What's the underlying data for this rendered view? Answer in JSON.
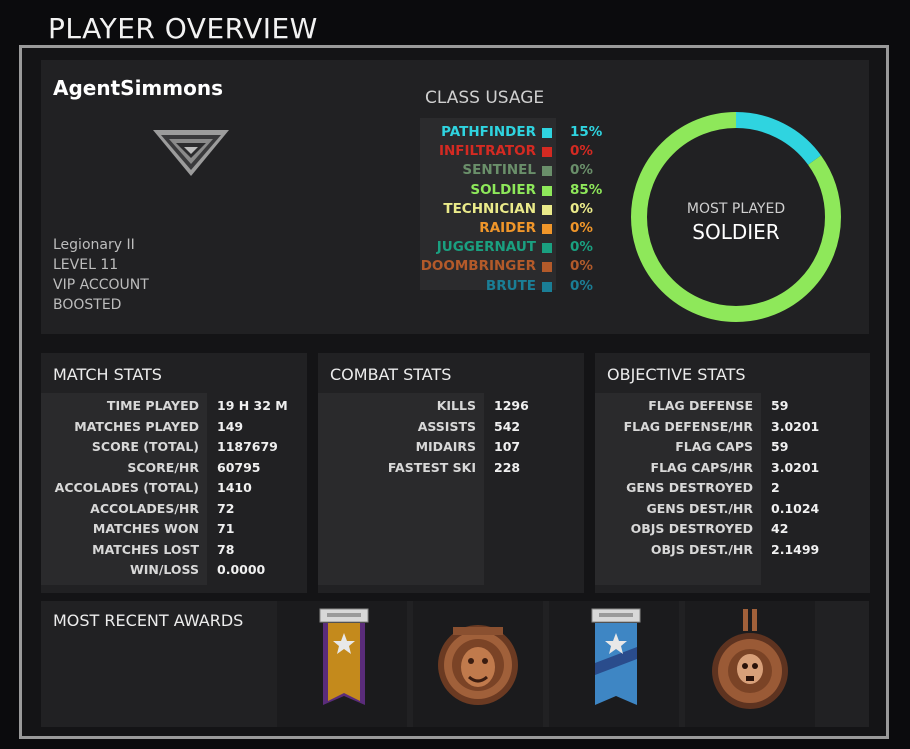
{
  "page": {
    "title": "PLAYER OVERVIEW"
  },
  "profile": {
    "player_name": "AgentSimmons",
    "rank": "Legionary II",
    "level": "LEVEL 11",
    "account": "VIP ACCOUNT",
    "boost": "BOOSTED",
    "emblem_icon": "rank-chevron-icon"
  },
  "class_usage": {
    "title": "CLASS USAGE",
    "classes": [
      {
        "name": "PATHFINDER",
        "percent": "15%",
        "color": "#2fd4e0"
      },
      {
        "name": "INFILTRATOR",
        "percent": "0%",
        "color": "#d42a22"
      },
      {
        "name": "SENTINEL",
        "percent": "0%",
        "color": "#6a8f6a"
      },
      {
        "name": "SOLDIER",
        "percent": "85%",
        "color": "#8ee85a"
      },
      {
        "name": "TECHNICIAN",
        "percent": "0%",
        "color": "#eaea8a"
      },
      {
        "name": "RAIDER",
        "percent": "0%",
        "color": "#f0962a"
      },
      {
        "name": "JUGGERNAUT",
        "percent": "0%",
        "color": "#1aa080"
      },
      {
        "name": "DOOMBRINGER",
        "percent": "0%",
        "color": "#b35a2a"
      },
      {
        "name": "BRUTE",
        "percent": "0%",
        "color": "#1a7e96"
      }
    ],
    "most_played_label": "MOST PLAYED",
    "most_played_class": "SOLDIER"
  },
  "chart_data": {
    "type": "pie",
    "style": "donut",
    "categories": [
      "PATHFINDER",
      "SOLDIER"
    ],
    "values": [
      15,
      85
    ],
    "colors": [
      "#2fd4e0",
      "#8ee85a"
    ]
  },
  "match_stats": {
    "title": "MATCH STATS",
    "rows": [
      {
        "label": "TIME PLAYED",
        "value": "19 H 32 M"
      },
      {
        "label": "MATCHES PLAYED",
        "value": "149"
      },
      {
        "label": "SCORE (TOTAL)",
        "value": "1187679"
      },
      {
        "label": "SCORE/HR",
        "value": "60795"
      },
      {
        "label": "ACCOLADES (TOTAL)",
        "value": "1410"
      },
      {
        "label": "ACCOLADES/HR",
        "value": "72"
      },
      {
        "label": "MATCHES WON",
        "value": "71"
      },
      {
        "label": "MATCHES LOST",
        "value": "78"
      },
      {
        "label": "WIN/LOSS",
        "value": "0.0000"
      }
    ]
  },
  "combat_stats": {
    "title": "COMBAT STATS",
    "rows": [
      {
        "label": "KILLS",
        "value": "1296"
      },
      {
        "label": "ASSISTS",
        "value": "542"
      },
      {
        "label": "MIDAIRS",
        "value": "107"
      },
      {
        "label": "FASTEST SKI",
        "value": "228"
      }
    ]
  },
  "objective_stats": {
    "title": "OBJECTIVE STATS",
    "rows": [
      {
        "label": "FLAG DEFENSE",
        "value": "59"
      },
      {
        "label": "FLAG DEFENSE/HR",
        "value": "3.0201"
      },
      {
        "label": "FLAG CAPS",
        "value": "59"
      },
      {
        "label": "FLAG CAPS/HR",
        "value": "3.0201"
      },
      {
        "label": "GENS DESTROYED",
        "value": "2"
      },
      {
        "label": "GENS DEST./HR",
        "value": "0.1024"
      },
      {
        "label": "OBJS DESTROYED",
        "value": "42"
      },
      {
        "label": "OBJS DEST./HR",
        "value": "2.1499"
      }
    ]
  },
  "awards": {
    "title": "MOST RECENT AWARDS",
    "items": [
      {
        "icon": "gold-ribbon-star-icon"
      },
      {
        "icon": "bronze-lion-medal-icon"
      },
      {
        "icon": "blue-ribbon-star-icon"
      },
      {
        "icon": "bronze-skull-medal-icon"
      }
    ]
  }
}
